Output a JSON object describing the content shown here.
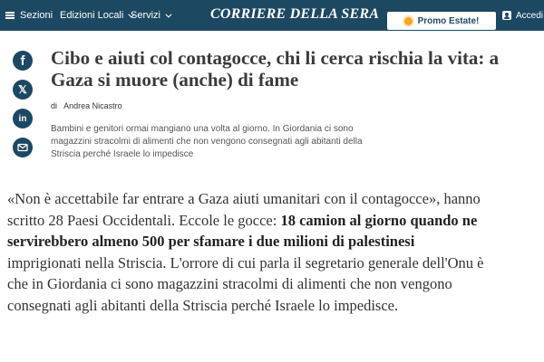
{
  "topbar": {
    "sezioni": "Sezioni",
    "edizioni": "Edizioni Locali",
    "servizi": "Servizi",
    "logo": "Corriere della Sera",
    "promo": "Promo Estate!",
    "accedi": "Accedi",
    "bg_color": "#1d4862"
  },
  "social": {
    "facebook": "f",
    "x": "𝕏",
    "linkedin": "in"
  },
  "article": {
    "headline": "Cibo e aiuti col contagocce, chi li cerca rischia la vita: a Gaza si muore (anche) di fame",
    "byline_prefix": "di",
    "author": "Andrea Nicastro",
    "summary": "Bambini e genitori ormai mangiano una volta al giorno. In Giordania ci sono magazzini stracolmi di alimenti che non vengono consegnati agli abitanti della Striscia perché Israele lo impedisce",
    "body_part1": "«Non è accettabile far entrare a Gaza aiuti umanitari con il contagocce», hanno scritto 28 Paesi Occidentali. Eccole le gocce: ",
    "body_bold": "18 camion al giorno quando ne servirebbero almeno 500 per sfamare i due milioni di palestinesi",
    "body_part2": " imprigionati nella Striscia. L'orrore di cui parla il segretario generale dell'Onu è che in Giordania ci sono magazzini stracolmi di alimenti che non vengono consegnati agli abitanti della Striscia perché Israele lo impedisce."
  }
}
